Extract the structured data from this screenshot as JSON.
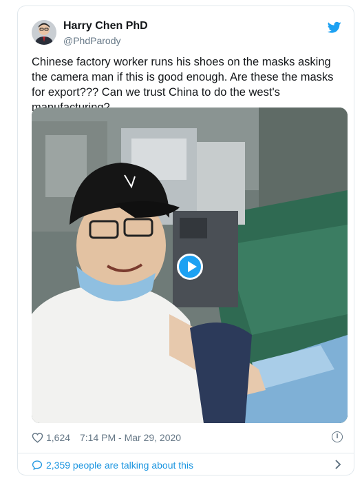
{
  "author": {
    "name": "Harry Chen PhD",
    "handle": "@PhdParody",
    "avatar_icon": "user-avatar"
  },
  "tweet": {
    "text": "Chinese factory worker runs his shoes on the masks asking the camera man if this is good enough. Are these the masks for export??? Can we trust China to do the west's manufacturing?",
    "media_type": "video",
    "play_icon": "play-icon"
  },
  "meta": {
    "likes": "1,624",
    "timestamp": "7:14 PM - Mar 29, 2020",
    "info_glyph": "i"
  },
  "footer": {
    "talking_text": "2,359 people are talking about this"
  },
  "colors": {
    "twitter_blue": "#1da1f2",
    "link_blue": "#1b95e0",
    "text": "#14171a",
    "muted": "#657786",
    "border": "#e1e8ed"
  }
}
